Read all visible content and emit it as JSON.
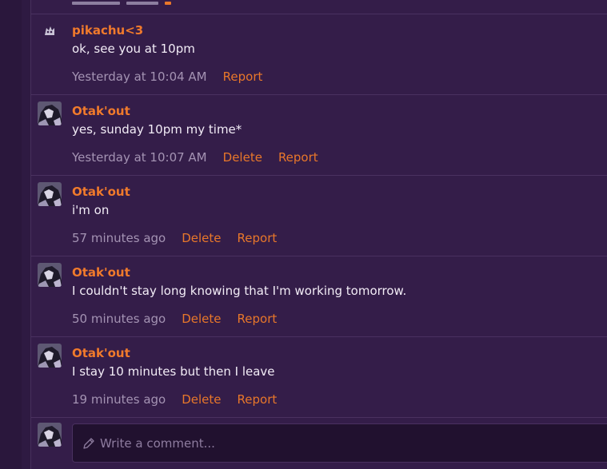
{
  "thread": {
    "comments": [
      {
        "username": "pikachu<3",
        "text": "ok, see you at 10pm",
        "time": "Yesterday at 10:04 AM",
        "actions": [
          "Report"
        ]
      },
      {
        "username": "Otak'out",
        "text": "yes, sunday 10pm my time*",
        "time": "Yesterday at 10:07 AM",
        "actions": [
          "Delete",
          "Report"
        ]
      },
      {
        "username": "Otak'out",
        "text": "i'm on",
        "time": "57 minutes ago",
        "actions": [
          "Delete",
          "Report"
        ]
      },
      {
        "username": "Otak'out",
        "text": "I couldn't stay long knowing that I'm working tomorrow.",
        "time": "50 minutes ago",
        "actions": [
          "Delete",
          "Report"
        ]
      },
      {
        "username": "Otak'out",
        "text": "I stay 10 minutes but then I leave",
        "time": "19 minutes ago",
        "actions": [
          "Delete",
          "Report"
        ]
      }
    ]
  },
  "reply": {
    "placeholder": "Write a comment...",
    "icon": "pencil-icon"
  },
  "colors": {
    "background": "#2e1a42",
    "panel": "#341d49",
    "accent": "#f07a2c",
    "text": "#f2ecf6",
    "muted": "#a493b3"
  }
}
